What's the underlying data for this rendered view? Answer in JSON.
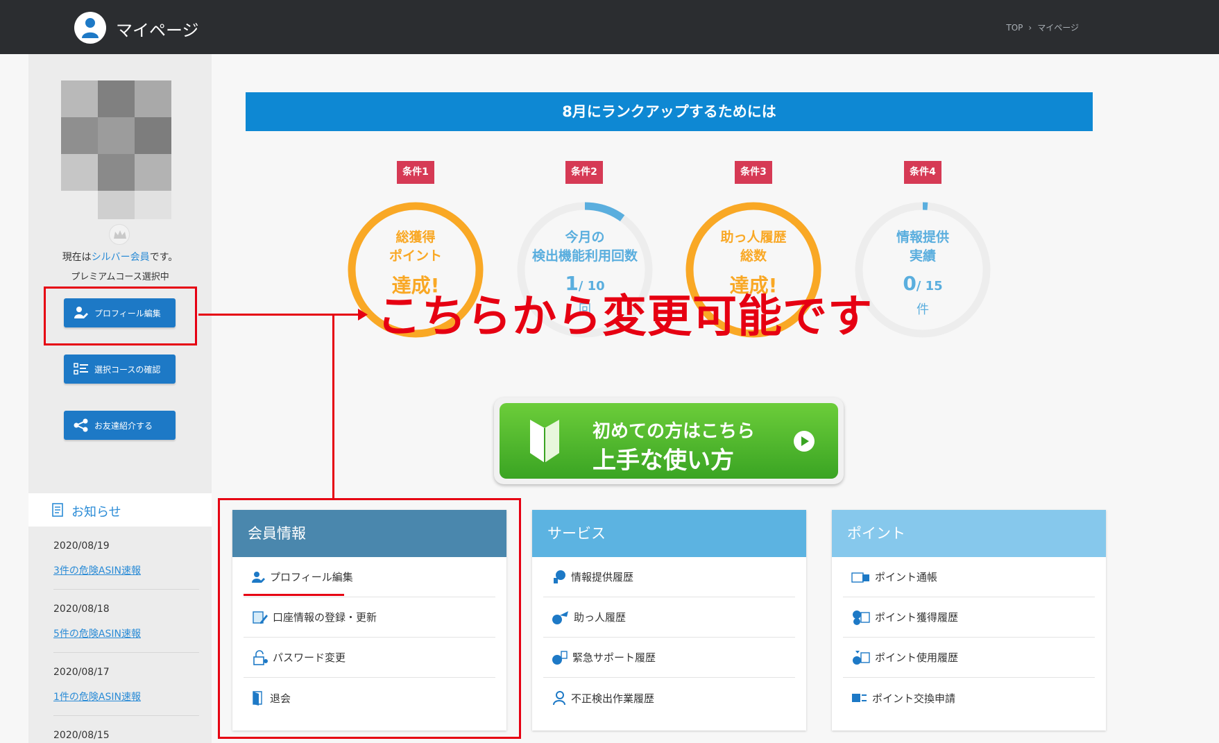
{
  "header": {
    "title": "マイページ",
    "breadcrumb": [
      "TOP",
      "マイページ"
    ],
    "breadcrumb_sep": "›"
  },
  "sidebar": {
    "rank_prefix": "現在は",
    "rank_link": "シルバー会員",
    "rank_suffix": "です。",
    "course": "プレミアムコース選択中",
    "buttons": [
      {
        "label": "プロフィール編集",
        "icon": "user-edit-icon"
      },
      {
        "label": "選択コースの確認",
        "icon": "checklist-icon"
      },
      {
        "label": "お友達紹介する",
        "icon": "share-icon"
      }
    ],
    "news_title": "お知らせ",
    "news": [
      {
        "date": "2020/08/19",
        "link": "3件の危険ASIN速報"
      },
      {
        "date": "2020/08/18",
        "link": "5件の危険ASIN速報"
      },
      {
        "date": "2020/08/17",
        "link": "1件の危険ASIN速報"
      },
      {
        "date": "2020/08/15",
        "link": ""
      }
    ]
  },
  "rank_up": {
    "banner": "8月にランクアップするためには",
    "conditions": [
      {
        "tag": "条件1",
        "line1": "総獲得",
        "line2": "ポイント",
        "big": "達成!",
        "sub": "",
        "achieved": true,
        "progress": 1.0
      },
      {
        "tag": "条件2",
        "line1": "今月の",
        "line2": "検出機能利用回数",
        "big": "1",
        "sub": "/ 10",
        "unit": "回",
        "achieved": false,
        "progress": 0.1
      },
      {
        "tag": "条件3",
        "line1": "助っ人履歴",
        "line2": "総数",
        "big": "達成!",
        "sub": "",
        "achieved": true,
        "progress": 1.0
      },
      {
        "tag": "条件4",
        "line1": "情報提供",
        "line2": "実績",
        "big": "0",
        "sub": "/ 15",
        "unit": "件",
        "achieved": false,
        "progress": 0.0
      }
    ],
    "colors": {
      "achieved": "#f9a825",
      "progress": "#5aaede",
      "track": "#ededed",
      "tag": "#d63a55"
    }
  },
  "annotation": {
    "text": "こちらから変更可能です",
    "color": "#e60012"
  },
  "guide_button": {
    "line1": "初めての方はこちら",
    "line2": "上手な使い方"
  },
  "panels": [
    {
      "title": "会員情報",
      "color": "#4a87ad",
      "items": [
        {
          "label": "プロフィール編集",
          "icon": "user-edit-icon"
        },
        {
          "label": "口座情報の登録・更新",
          "icon": "pen-document-icon"
        },
        {
          "label": "パスワード変更",
          "icon": "lock-icon"
        },
        {
          "label": "退会",
          "icon": "exit-door-icon"
        }
      ]
    },
    {
      "title": "サービス",
      "color": "#5cb3e1",
      "items": [
        {
          "label": "情報提供履歴",
          "icon": "info-history-icon"
        },
        {
          "label": "助っ人履歴",
          "icon": "helper-history-icon"
        },
        {
          "label": "緊急サポート履歴",
          "icon": "emergency-support-icon"
        },
        {
          "label": "不正検出作業履歴",
          "icon": "fraud-detect-icon"
        }
      ]
    },
    {
      "title": "ポイント",
      "color": "#86c8ec",
      "items": [
        {
          "label": "ポイント通帳",
          "icon": "point-passbook-icon"
        },
        {
          "label": "ポイント獲得履歴",
          "icon": "point-earn-history-icon"
        },
        {
          "label": "ポイント使用履歴",
          "icon": "point-use-history-icon"
        },
        {
          "label": "ポイント交換申請",
          "icon": "point-exchange-icon"
        }
      ]
    }
  ]
}
